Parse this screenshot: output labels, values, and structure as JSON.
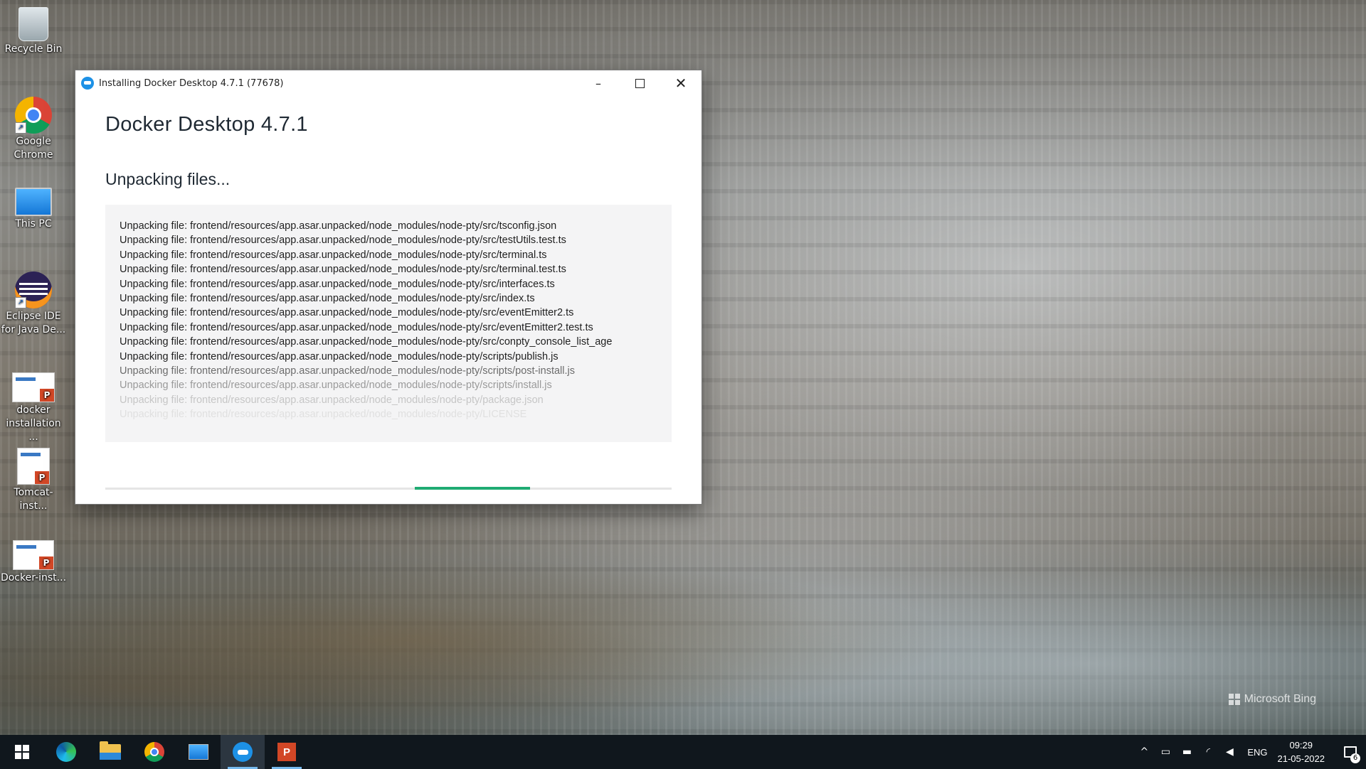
{
  "desktop": {
    "icons": [
      {
        "label": "Recycle Bin",
        "icon": "recycle-bin-icon"
      },
      {
        "label": "Google Chrome",
        "icon": "chrome-icon"
      },
      {
        "label": "This PC",
        "icon": "this-pc-icon"
      },
      {
        "label": "Eclipse IDE for Java De...",
        "icon": "eclipse-icon"
      },
      {
        "label": "docker installation ...",
        "icon": "document-icon"
      },
      {
        "label": "Tomcat-inst...",
        "icon": "powerpoint-file-icon"
      },
      {
        "label": "Docker-inst...",
        "icon": "powerpoint-file-icon"
      }
    ],
    "watermark": "Microsoft Bing"
  },
  "window": {
    "title": "Installing Docker Desktop 4.7.1 (77678)",
    "minimize_glyph": "–",
    "close_glyph": "✕",
    "product_title": "Docker Desktop  4.7.1",
    "status": "Unpacking files...",
    "log_lines": [
      "Unpacking file: frontend/resources/app.asar.unpacked/node_modules/node-pty/src/tsconfig.json",
      "Unpacking file: frontend/resources/app.asar.unpacked/node_modules/node-pty/src/testUtils.test.ts",
      "Unpacking file: frontend/resources/app.asar.unpacked/node_modules/node-pty/src/terminal.ts",
      "Unpacking file: frontend/resources/app.asar.unpacked/node_modules/node-pty/src/terminal.test.ts",
      "Unpacking file: frontend/resources/app.asar.unpacked/node_modules/node-pty/src/interfaces.ts",
      "Unpacking file: frontend/resources/app.asar.unpacked/node_modules/node-pty/src/index.ts",
      "Unpacking file: frontend/resources/app.asar.unpacked/node_modules/node-pty/src/eventEmitter2.ts",
      "Unpacking file: frontend/resources/app.asar.unpacked/node_modules/node-pty/src/eventEmitter2.test.ts",
      "Unpacking file: frontend/resources/app.asar.unpacked/node_modules/node-pty/src/conpty_console_list_age",
      "Unpacking file: frontend/resources/app.asar.unpacked/node_modules/node-pty/scripts/publish.js",
      "Unpacking file: frontend/resources/app.asar.unpacked/node_modules/node-pty/scripts/post-install.js",
      "Unpacking file: frontend/resources/app.asar.unpacked/node_modules/node-pty/scripts/install.js",
      "Unpacking file: frontend/resources/app.asar.unpacked/node_modules/node-pty/package.json",
      "Unpacking file: frontend/resources/app.asar.unpacked/node_modules/node-pty/LICENSE"
    ],
    "progress": {
      "start": 0.546,
      "end": 0.75,
      "indeterminate": true,
      "color": "#1fab73"
    }
  },
  "taskbar": {
    "items": [
      {
        "icon": "windows-start-icon"
      },
      {
        "icon": "edge-icon"
      },
      {
        "icon": "file-explorer-icon"
      },
      {
        "icon": "chrome-icon"
      },
      {
        "icon": "this-pc-icon"
      },
      {
        "icon": "docker-icon",
        "active": true
      },
      {
        "icon": "powerpoint-icon",
        "running": true
      }
    ],
    "tray": {
      "chevron": "^",
      "language": "ENG",
      "time": "09:29",
      "date": "21-05-2022",
      "notification_count": "6"
    }
  }
}
